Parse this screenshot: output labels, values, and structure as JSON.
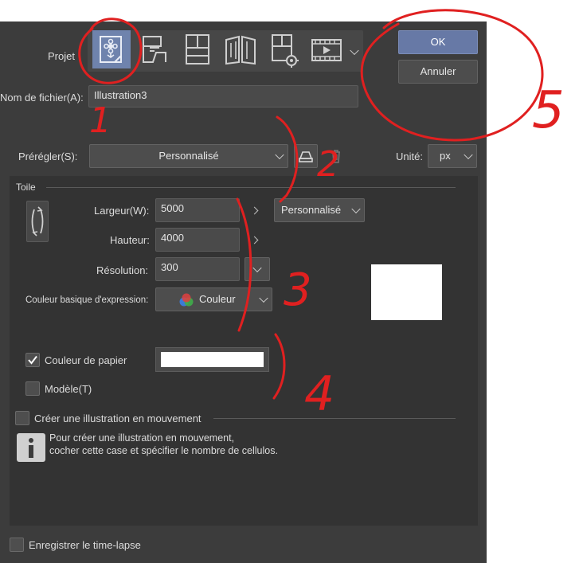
{
  "project": {
    "label": "Projet",
    "types": [
      {
        "icon": "illustration-icon",
        "selected": true
      },
      {
        "icon": "webtoon-icon",
        "selected": false
      },
      {
        "icon": "comic-icon",
        "selected": false
      },
      {
        "icon": "book-icon",
        "selected": false
      },
      {
        "icon": "page-settings-icon",
        "selected": false
      },
      {
        "icon": "animation-icon",
        "selected": false
      }
    ]
  },
  "filename": {
    "label": "Nom de fichier(A):",
    "value": "Illustration3"
  },
  "buttons": {
    "ok": "OK",
    "cancel": "Annuler"
  },
  "preset": {
    "label": "Prérégler(S):",
    "value": "Personnalisé"
  },
  "unit": {
    "label": "Unité:",
    "value": "px"
  },
  "canvas": {
    "section": "Toile",
    "width": {
      "label": "Largeur(W):",
      "value": "5000"
    },
    "height": {
      "label": "Hauteur:",
      "value": "4000"
    },
    "size_preset": "Personnalisé",
    "resolution": {
      "label": "Résolution:",
      "value": "300"
    },
    "color": {
      "label": "Couleur basique d'expression:",
      "value": "Couleur"
    }
  },
  "paper": {
    "label": "Couleur de papier",
    "checked": true,
    "color": "#ffffff"
  },
  "template": {
    "label": "Modèle(T)",
    "checked": false
  },
  "animation": {
    "label": "Créer une illustration en mouvement",
    "checked": false,
    "info_line1": "Pour créer une illustration en mouvement,",
    "info_line2": "cocher cette case et spécifier le nombre de cellulos."
  },
  "timelapse": {
    "label": "Enregistrer le time-lapse",
    "checked": false
  },
  "annotations": {
    "n1": "1",
    "n2": "2",
    "n3": "3",
    "n4": "4",
    "n5": "5",
    "color": "#e02020"
  }
}
